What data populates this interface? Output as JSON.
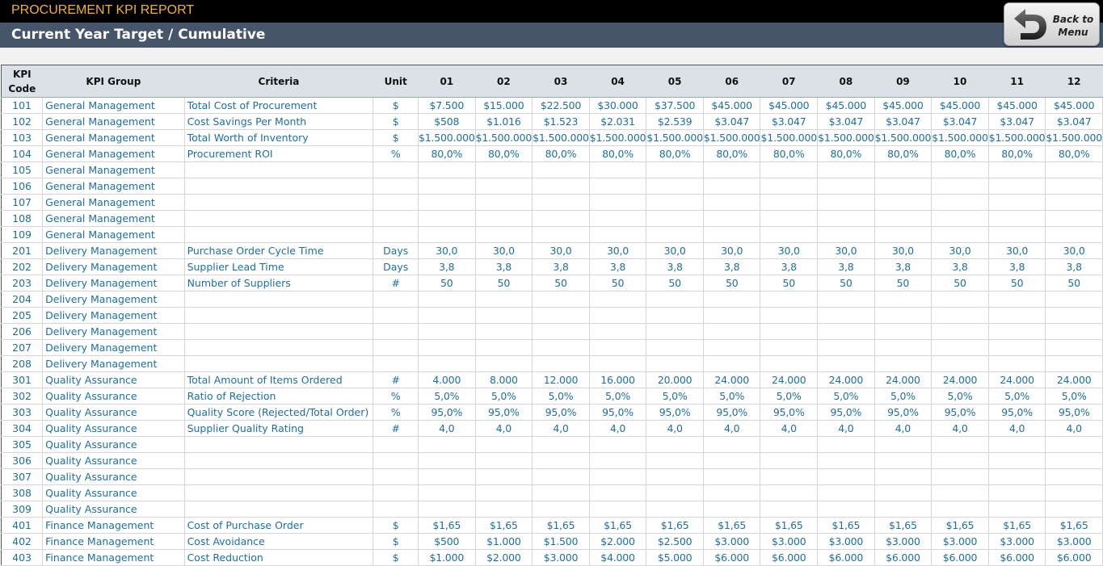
{
  "header": {
    "app_title": "PROCUREMENT KPI REPORT",
    "subtitle": "Current Year Target / Cumulative",
    "back_button": {
      "line1": "Back to",
      "line2": "Menu",
      "icon": "undo-arrow-icon"
    }
  },
  "colors": {
    "title_text": "#f2b035",
    "subtitle_bg": "#465569",
    "cell_text": "#1f6f9e",
    "header_bg": "#dce1e7"
  },
  "table": {
    "headers": {
      "code_line1": "KPI",
      "code_line2": "Code",
      "group": "KPI Group",
      "criteria": "Criteria",
      "unit": "Unit",
      "months": [
        "01",
        "02",
        "03",
        "04",
        "05",
        "06",
        "07",
        "08",
        "09",
        "10",
        "11",
        "12"
      ]
    },
    "rows": [
      {
        "code": "101",
        "group": "General Management",
        "criteria": "Total Cost of Procurement",
        "unit": "$",
        "values": [
          "$7.500",
          "$15.000",
          "$22.500",
          "$30.000",
          "$37.500",
          "$45.000",
          "$45.000",
          "$45.000",
          "$45.000",
          "$45.000",
          "$45.000",
          "$45.000"
        ]
      },
      {
        "code": "102",
        "group": "General Management",
        "criteria": "Cost Savings Per Month",
        "unit": "$",
        "values": [
          "$508",
          "$1.016",
          "$1.523",
          "$2.031",
          "$2.539",
          "$3.047",
          "$3.047",
          "$3.047",
          "$3.047",
          "$3.047",
          "$3.047",
          "$3.047"
        ]
      },
      {
        "code": "103",
        "group": "General Management",
        "criteria": "Total Worth of Inventory",
        "unit": "$",
        "values": [
          "$1.500.000",
          "$1.500.000",
          "$1.500.000",
          "$1.500.000",
          "$1.500.000",
          "$1.500.000",
          "$1.500.000",
          "$1.500.000",
          "$1.500.000",
          "$1.500.000",
          "$1.500.000",
          "$1.500.000"
        ]
      },
      {
        "code": "104",
        "group": "General Management",
        "criteria": "Procurement ROI",
        "unit": "%",
        "values": [
          "80,0%",
          "80,0%",
          "80,0%",
          "80,0%",
          "80,0%",
          "80,0%",
          "80,0%",
          "80,0%",
          "80,0%",
          "80,0%",
          "80,0%",
          "80,0%"
        ]
      },
      {
        "code": "105",
        "group": "General Management",
        "criteria": "",
        "unit": "",
        "values": [
          "",
          "",
          "",
          "",
          "",
          "",
          "",
          "",
          "",
          "",
          "",
          ""
        ]
      },
      {
        "code": "106",
        "group": "General Management",
        "criteria": "",
        "unit": "",
        "values": [
          "",
          "",
          "",
          "",
          "",
          "",
          "",
          "",
          "",
          "",
          "",
          ""
        ]
      },
      {
        "code": "107",
        "group": "General Management",
        "criteria": "",
        "unit": "",
        "values": [
          "",
          "",
          "",
          "",
          "",
          "",
          "",
          "",
          "",
          "",
          "",
          ""
        ]
      },
      {
        "code": "108",
        "group": "General Management",
        "criteria": "",
        "unit": "",
        "values": [
          "",
          "",
          "",
          "",
          "",
          "",
          "",
          "",
          "",
          "",
          "",
          ""
        ]
      },
      {
        "code": "109",
        "group": "General Management",
        "criteria": "",
        "unit": "",
        "values": [
          "",
          "",
          "",
          "",
          "",
          "",
          "",
          "",
          "",
          "",
          "",
          ""
        ]
      },
      {
        "code": "201",
        "group": "Delivery Management",
        "criteria": "Purchase Order Cycle Time",
        "unit": "Days",
        "values": [
          "30,0",
          "30,0",
          "30,0",
          "30,0",
          "30,0",
          "30,0",
          "30,0",
          "30,0",
          "30,0",
          "30,0",
          "30,0",
          "30,0"
        ]
      },
      {
        "code": "202",
        "group": "Delivery Management",
        "criteria": "Supplier Lead Time",
        "unit": "Days",
        "values": [
          "3,8",
          "3,8",
          "3,8",
          "3,8",
          "3,8",
          "3,8",
          "3,8",
          "3,8",
          "3,8",
          "3,8",
          "3,8",
          "3,8"
        ]
      },
      {
        "code": "203",
        "group": "Delivery Management",
        "criteria": "Number of Suppliers",
        "unit": "#",
        "values": [
          "50",
          "50",
          "50",
          "50",
          "50",
          "50",
          "50",
          "50",
          "50",
          "50",
          "50",
          "50"
        ]
      },
      {
        "code": "204",
        "group": "Delivery Management",
        "criteria": "",
        "unit": "",
        "values": [
          "",
          "",
          "",
          "",
          "",
          "",
          "",
          "",
          "",
          "",
          "",
          ""
        ]
      },
      {
        "code": "205",
        "group": "Delivery Management",
        "criteria": "",
        "unit": "",
        "values": [
          "",
          "",
          "",
          "",
          "",
          "",
          "",
          "",
          "",
          "",
          "",
          ""
        ]
      },
      {
        "code": "206",
        "group": "Delivery Management",
        "criteria": "",
        "unit": "",
        "values": [
          "",
          "",
          "",
          "",
          "",
          "",
          "",
          "",
          "",
          "",
          "",
          ""
        ]
      },
      {
        "code": "207",
        "group": "Delivery Management",
        "criteria": "",
        "unit": "",
        "values": [
          "",
          "",
          "",
          "",
          "",
          "",
          "",
          "",
          "",
          "",
          "",
          ""
        ]
      },
      {
        "code": "208",
        "group": "Delivery Management",
        "criteria": "",
        "unit": "",
        "values": [
          "",
          "",
          "",
          "",
          "",
          "",
          "",
          "",
          "",
          "",
          "",
          ""
        ]
      },
      {
        "code": "301",
        "group": "Quality Assurance",
        "criteria": "Total Amount of Items Ordered",
        "unit": "#",
        "values": [
          "4.000",
          "8.000",
          "12.000",
          "16.000",
          "20.000",
          "24.000",
          "24.000",
          "24.000",
          "24.000",
          "24.000",
          "24.000",
          "24.000"
        ]
      },
      {
        "code": "302",
        "group": "Quality Assurance",
        "criteria": "Ratio of Rejection",
        "unit": "%",
        "values": [
          "5,0%",
          "5,0%",
          "5,0%",
          "5,0%",
          "5,0%",
          "5,0%",
          "5,0%",
          "5,0%",
          "5,0%",
          "5,0%",
          "5,0%",
          "5,0%"
        ]
      },
      {
        "code": "303",
        "group": "Quality Assurance",
        "criteria": "Quality Score (Rejected/Total Order)",
        "unit": "%",
        "values": [
          "95,0%",
          "95,0%",
          "95,0%",
          "95,0%",
          "95,0%",
          "95,0%",
          "95,0%",
          "95,0%",
          "95,0%",
          "95,0%",
          "95,0%",
          "95,0%"
        ]
      },
      {
        "code": "304",
        "group": "Quality Assurance",
        "criteria": "Supplier Quality Rating",
        "unit": "#",
        "values": [
          "4,0",
          "4,0",
          "4,0",
          "4,0",
          "4,0",
          "4,0",
          "4,0",
          "4,0",
          "4,0",
          "4,0",
          "4,0",
          "4,0"
        ]
      },
      {
        "code": "305",
        "group": "Quality Assurance",
        "criteria": "",
        "unit": "",
        "values": [
          "",
          "",
          "",
          "",
          "",
          "",
          "",
          "",
          "",
          "",
          "",
          ""
        ]
      },
      {
        "code": "306",
        "group": "Quality Assurance",
        "criteria": "",
        "unit": "",
        "values": [
          "",
          "",
          "",
          "",
          "",
          "",
          "",
          "",
          "",
          "",
          "",
          ""
        ]
      },
      {
        "code": "307",
        "group": "Quality Assurance",
        "criteria": "",
        "unit": "",
        "values": [
          "",
          "",
          "",
          "",
          "",
          "",
          "",
          "",
          "",
          "",
          "",
          ""
        ]
      },
      {
        "code": "308",
        "group": "Quality Assurance",
        "criteria": "",
        "unit": "",
        "values": [
          "",
          "",
          "",
          "",
          "",
          "",
          "",
          "",
          "",
          "",
          "",
          ""
        ]
      },
      {
        "code": "309",
        "group": "Quality Assurance",
        "criteria": "",
        "unit": "",
        "values": [
          "",
          "",
          "",
          "",
          "",
          "",
          "",
          "",
          "",
          "",
          "",
          ""
        ]
      },
      {
        "code": "401",
        "group": "Finance Management",
        "criteria": "Cost of Purchase Order",
        "unit": "$",
        "values": [
          "$1,65",
          "$1,65",
          "$1,65",
          "$1,65",
          "$1,65",
          "$1,65",
          "$1,65",
          "$1,65",
          "$1,65",
          "$1,65",
          "$1,65",
          "$1,65"
        ]
      },
      {
        "code": "402",
        "group": "Finance Management",
        "criteria": "Cost Avoidance",
        "unit": "$",
        "values": [
          "$500",
          "$1.000",
          "$1.500",
          "$2.000",
          "$2.500",
          "$3.000",
          "$3.000",
          "$3.000",
          "$3.000",
          "$3.000",
          "$3.000",
          "$3.000"
        ]
      },
      {
        "code": "403",
        "group": "Finance Management",
        "criteria": "Cost Reduction",
        "unit": "$",
        "values": [
          "$1.000",
          "$2.000",
          "$3.000",
          "$4.000",
          "$5.000",
          "$6.000",
          "$6.000",
          "$6.000",
          "$6.000",
          "$6.000",
          "$6.000",
          "$6.000"
        ]
      }
    ]
  }
}
